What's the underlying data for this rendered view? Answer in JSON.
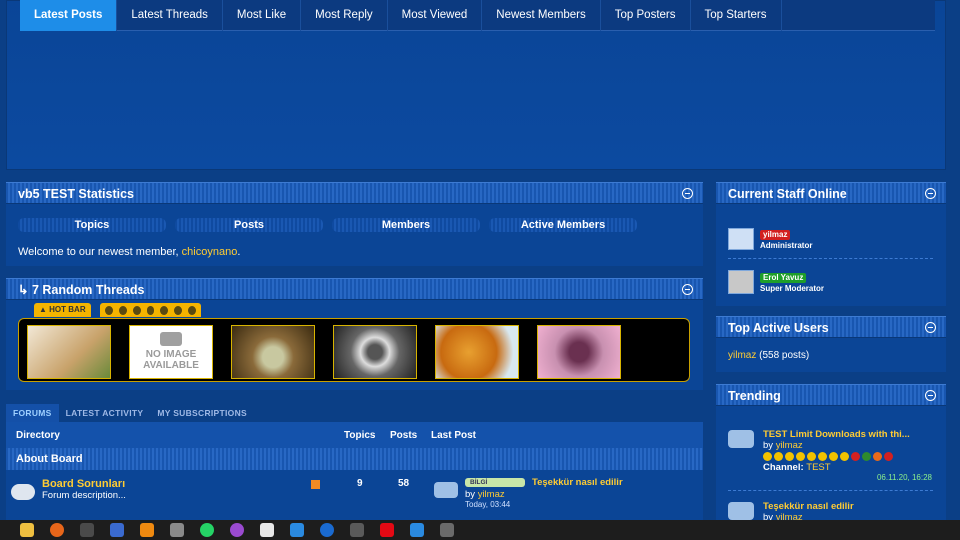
{
  "topnav": {
    "tabs": [
      "Latest Posts",
      "Latest Threads",
      "Most Like",
      "Most Reply",
      "Most Viewed",
      "Newest Members",
      "Top Posters",
      "Top Starters"
    ]
  },
  "stats": {
    "title": "vb5 TEST Statistics",
    "labels": [
      "Topics",
      "Posts",
      "Members",
      "Active Members"
    ],
    "welcome_prefix": "Welcome to our newest member, ",
    "newest_member": "chicoynano",
    "welcome_suffix": "."
  },
  "random": {
    "title": "↳ 7 Random Threads",
    "hotbar": "HOT BAR",
    "no_image": "NO IMAGE AVAILABLE"
  },
  "forum": {
    "tabs": [
      "FORUMS",
      "LATEST ACTIVITY",
      "MY SUBSCRIPTIONS"
    ],
    "cols": {
      "directory": "Directory",
      "topics": "Topics",
      "posts": "Posts",
      "last_post": "Last Post"
    },
    "category": "About Board",
    "row": {
      "name": "Board Sorunları",
      "desc": "Forum description...",
      "topics": "9",
      "posts": "58",
      "prefix": "BİLGİ",
      "last_title": "Teşekkür nasıl edilir",
      "by": "by ",
      "author": "yilmaz",
      "when": "Today, 03:44"
    }
  },
  "staff": {
    "title": "Current Staff Online",
    "members": [
      {
        "name": "yilmaz",
        "role": "Administrator",
        "color": "#d21f1f"
      },
      {
        "name": "Erol Yavuz",
        "role": "Super Moderator",
        "color": "#1e9e2a"
      }
    ]
  },
  "top_users": {
    "title": "Top Active Users",
    "user": "yilmaz",
    "count": " (558 posts)"
  },
  "trending": {
    "title": "Trending",
    "items": [
      {
        "title": "TEST Limit Downloads with thi...",
        "by": "by ",
        "author": "yilmaz",
        "channel_label": "Channel: ",
        "channel": "TEST",
        "date": "06.11.20, 16:28"
      },
      {
        "title": "Teşekkür nasıl edilir",
        "by": "by ",
        "author": "yilmaz"
      }
    ]
  },
  "colors": {
    "accent": "#1e8de8",
    "gold": "#ffcc33",
    "background": "#0b3f86"
  }
}
